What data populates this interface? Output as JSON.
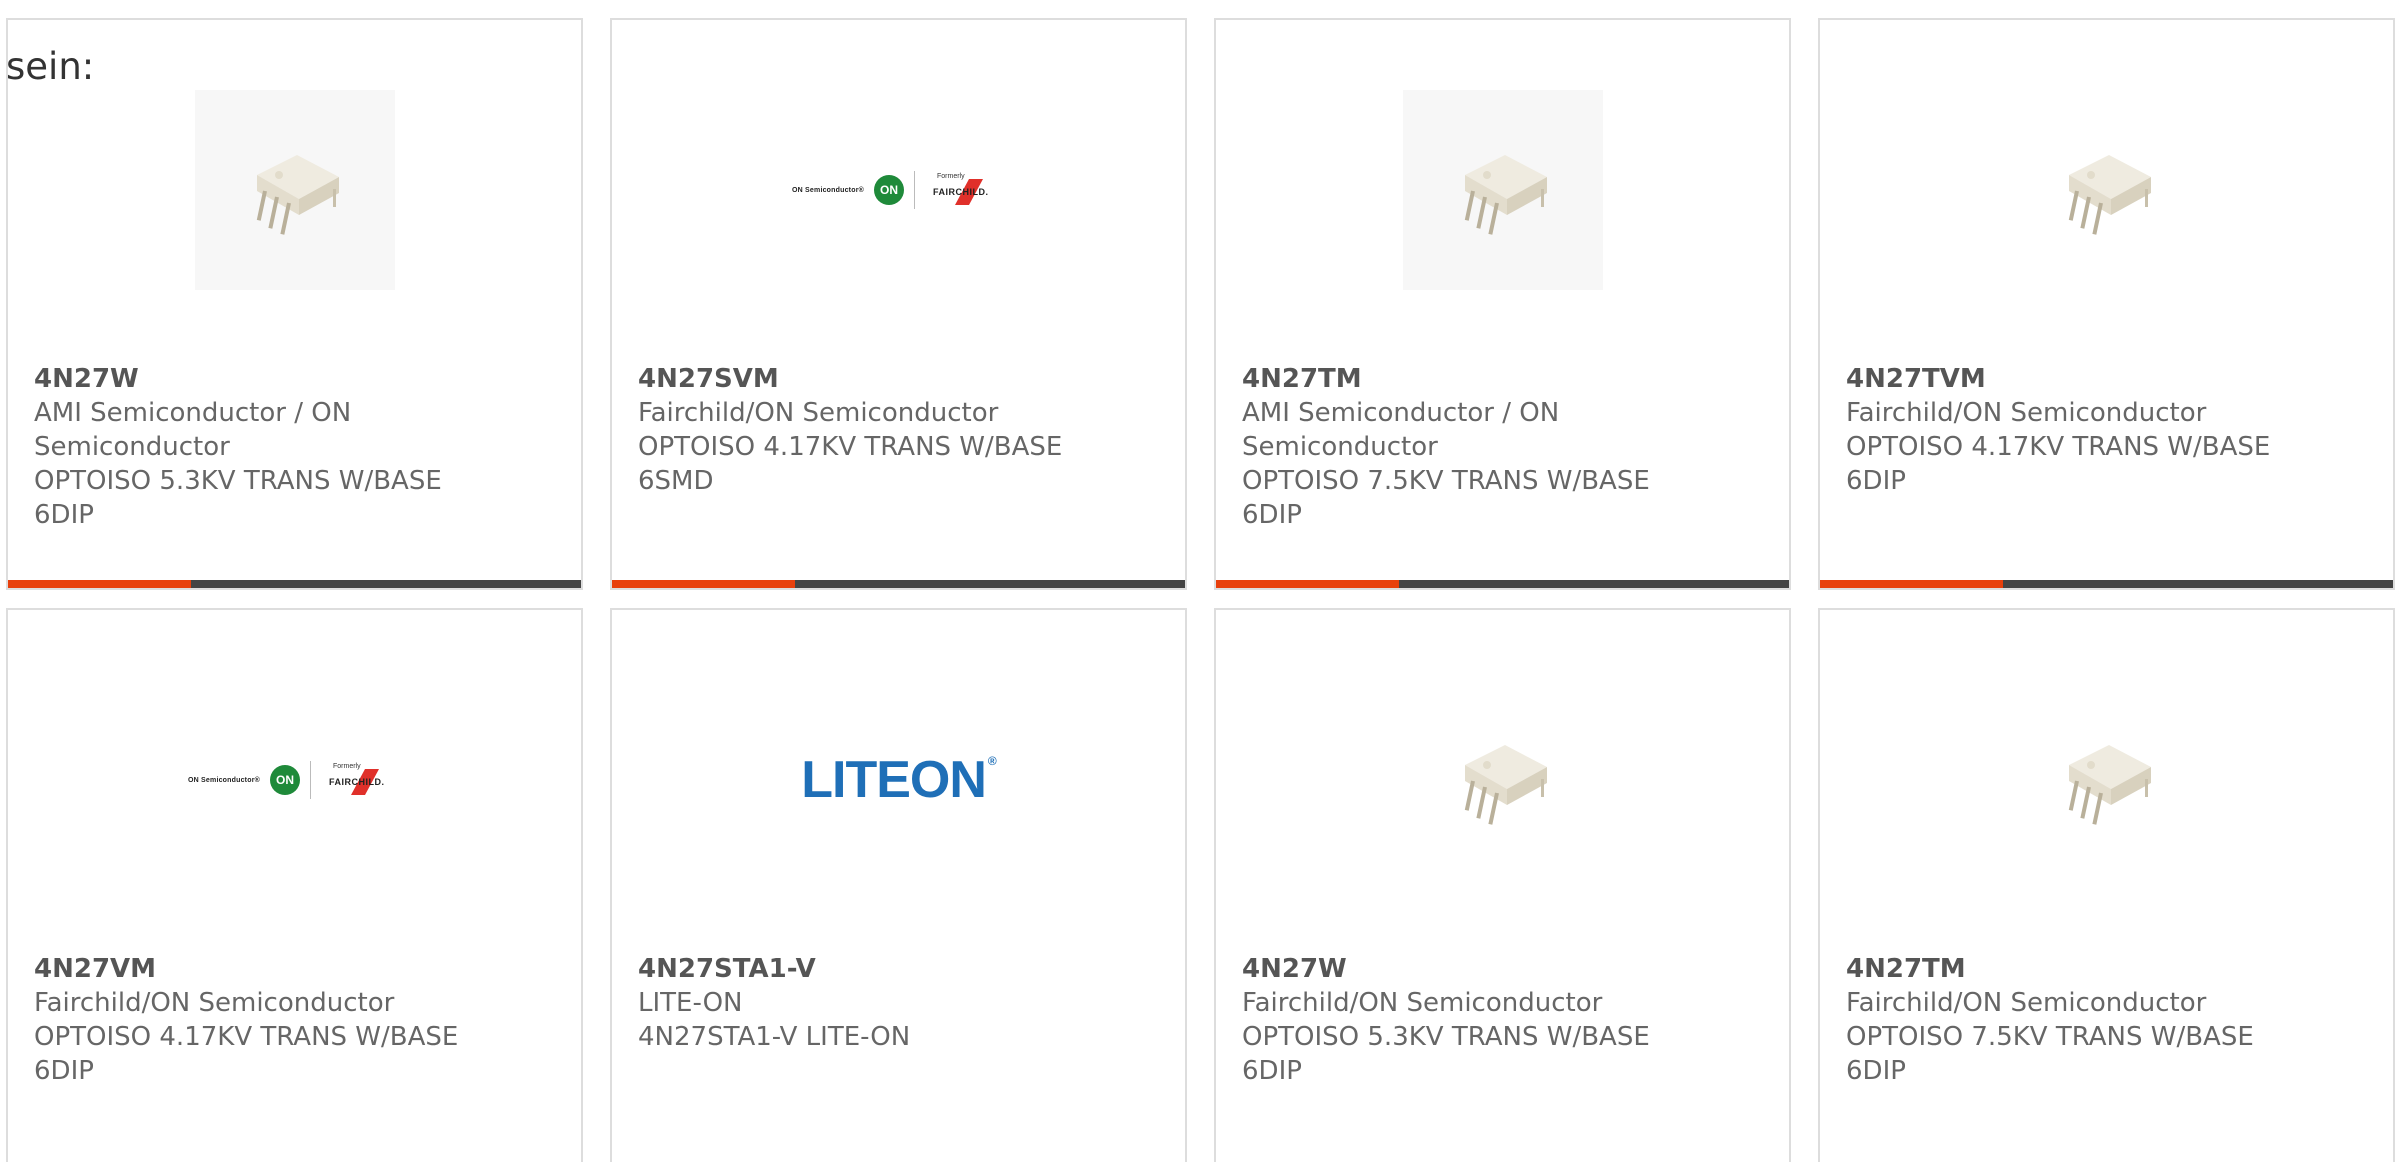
{
  "intro_text": "sein:",
  "colors": {
    "accent_bar": "#e8400c",
    "dark_bar": "#444444",
    "on_green": "#1f8a3a",
    "liteon_blue": "#1f6fb7"
  },
  "products": [
    {
      "part_number": "4N27W",
      "manufacturer": "AMI Semiconductor / ON Semiconductor",
      "description": "OPTOISO 5.3KV TRANS W/BASE 6DIP",
      "image": "optocoupler-chip-image"
    },
    {
      "part_number": "4N27SVM",
      "manufacturer": "Fairchild/ON Semiconductor",
      "description": "OPTOISO 4.17KV TRANS W/BASE 6SMD",
      "image": "on-semiconductor-fairchild-logo"
    },
    {
      "part_number": "4N27TM",
      "manufacturer": "AMI Semiconductor / ON Semiconductor",
      "description": "OPTOISO 7.5KV TRANS W/BASE 6DIP",
      "image": "optocoupler-chip-image"
    },
    {
      "part_number": "4N27TVM",
      "manufacturer": "Fairchild/ON Semiconductor",
      "description": "OPTOISO 4.17KV TRANS W/BASE 6DIP",
      "image": "optocoupler-chip-image"
    },
    {
      "part_number": "4N27VM",
      "manufacturer": "Fairchild/ON Semiconductor",
      "description": "OPTOISO 4.17KV TRANS W/BASE 6DIP",
      "image": "on-semiconductor-fairchild-logo"
    },
    {
      "part_number": "4N27STA1-V",
      "manufacturer": "LITE-ON",
      "description": "4N27STA1-V LITE-ON",
      "image": "liteon-logo"
    },
    {
      "part_number": "4N27W",
      "manufacturer": "Fairchild/ON Semiconductor",
      "description": "OPTOISO 5.3KV TRANS W/BASE 6DIP",
      "image": "optocoupler-chip-image"
    },
    {
      "part_number": "4N27TM",
      "manufacturer": "Fairchild/ON Semiconductor",
      "description": "OPTOISO 7.5KV TRANS W/BASE 6DIP",
      "image": "optocoupler-chip-image"
    }
  ],
  "logos": {
    "on_semi_text": "ON Semiconductor®",
    "on_circle": "ON",
    "formerly": "Formerly",
    "fairchild": "FAIRCHILD.",
    "liteon": "LITEON",
    "liteon_reg": "®"
  }
}
